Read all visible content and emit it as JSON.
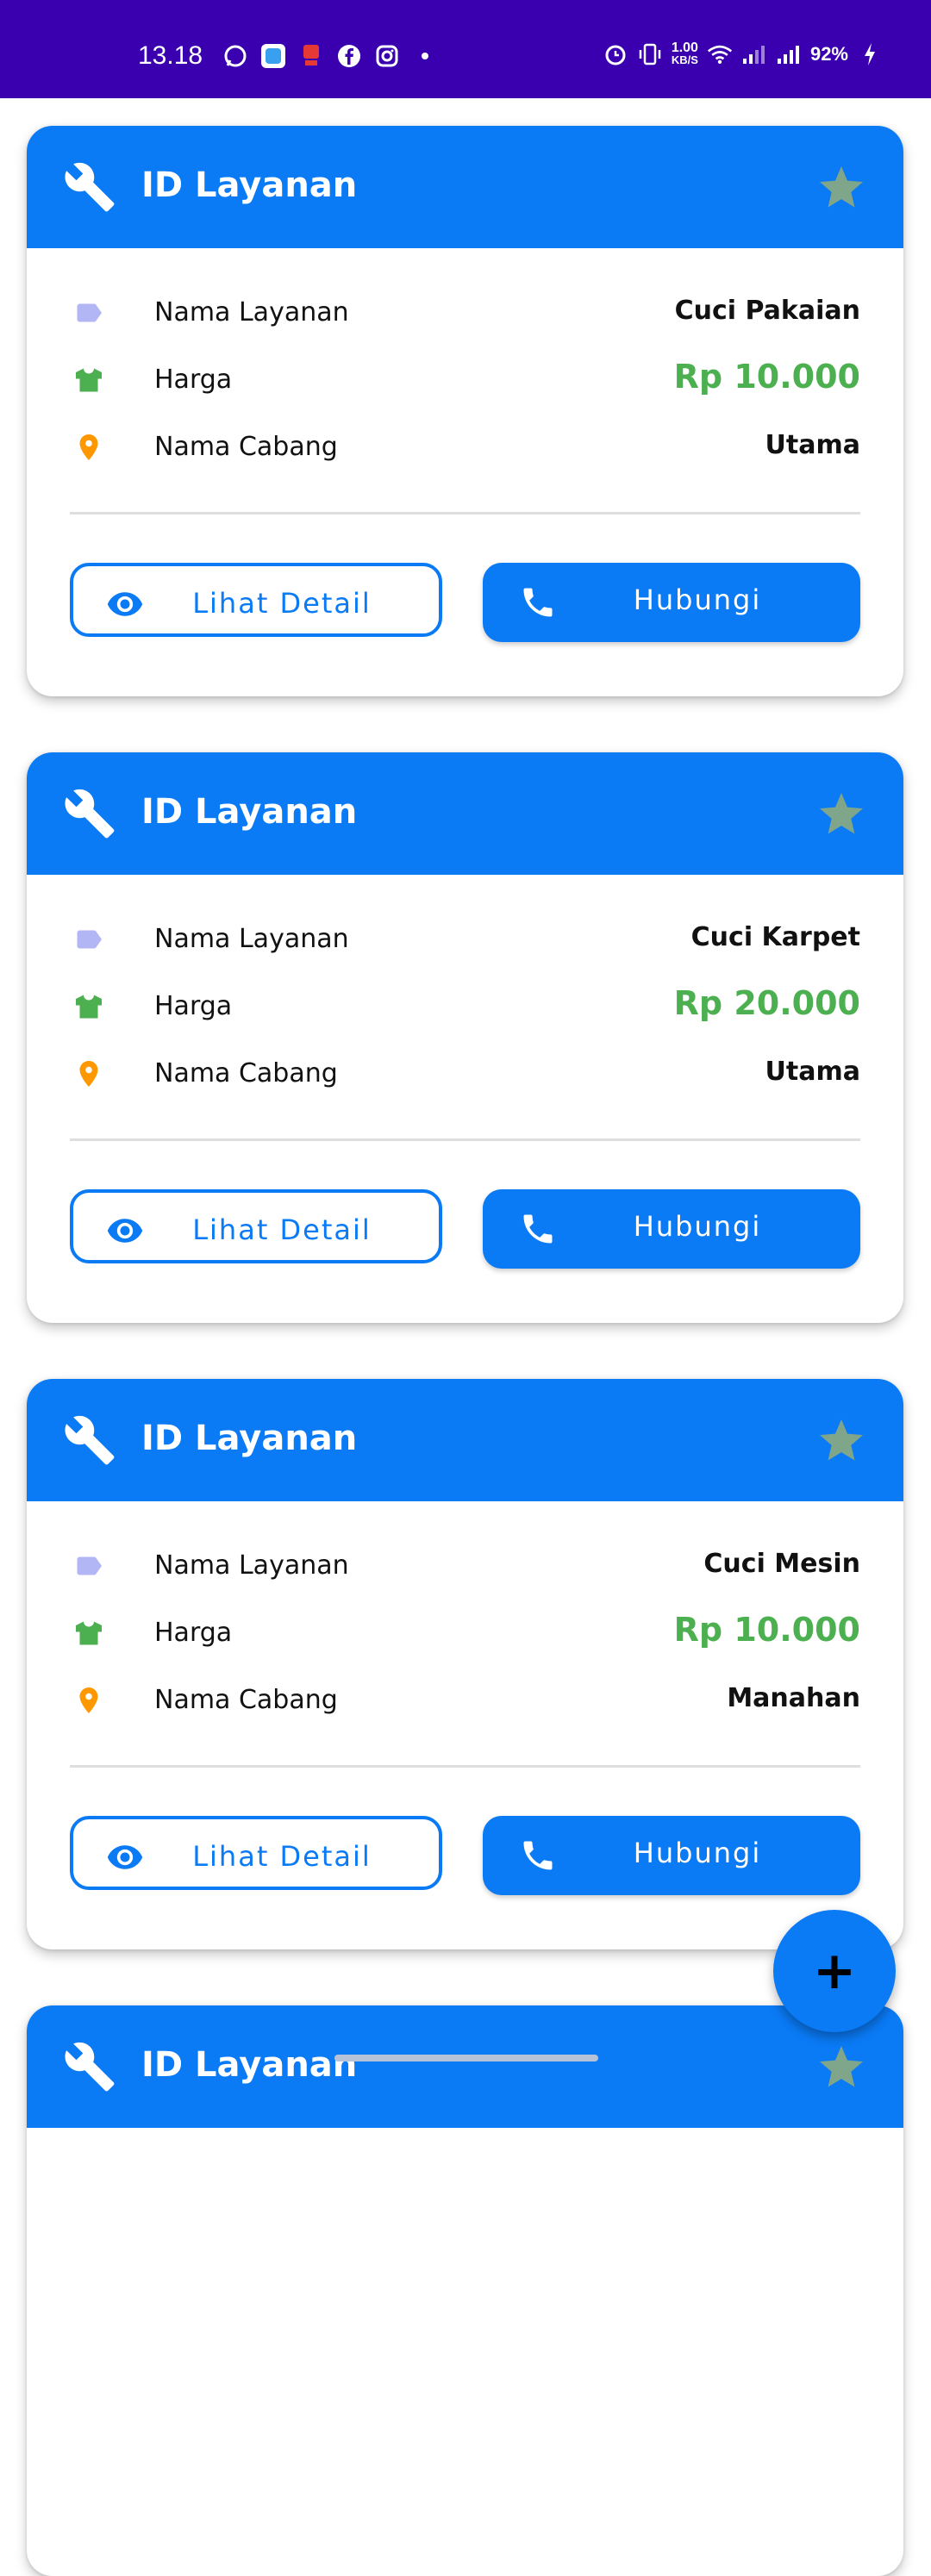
{
  "status_bar": {
    "time": "13.18",
    "speed_value": "1.00",
    "speed_unit": "KB/S",
    "battery": "92%"
  },
  "colors": {
    "header": "#0a7af5",
    "status_bar": "#3a00b0",
    "price": "#4caf50",
    "star": "#7fa58a",
    "tag_icon": "#b3b6f5",
    "shirt_icon": "#4caf50",
    "pin_icon": "#ff9800"
  },
  "cards": [
    {
      "title": "ID Layanan",
      "rows": [
        {
          "icon": "tag-icon",
          "label": "Nama Layanan",
          "value": "Cuci Pakaian"
        },
        {
          "icon": "shirt-icon",
          "label": "Harga",
          "value": "Rp 10.000"
        },
        {
          "icon": "location-pin-icon",
          "label": "Nama Cabang",
          "value": "Utama"
        }
      ],
      "detail_label": "Lihat Detail",
      "call_label": "Hubungi"
    },
    {
      "title": "ID Layanan",
      "rows": [
        {
          "icon": "tag-icon",
          "label": "Nama Layanan",
          "value": "Cuci Karpet"
        },
        {
          "icon": "shirt-icon",
          "label": "Harga",
          "value": "Rp 20.000"
        },
        {
          "icon": "location-pin-icon",
          "label": "Nama Cabang",
          "value": "Utama"
        }
      ],
      "detail_label": "Lihat Detail",
      "call_label": "Hubungi"
    },
    {
      "title": "ID Layanan",
      "rows": [
        {
          "icon": "tag-icon",
          "label": "Nama Layanan",
          "value": "Cuci Mesin"
        },
        {
          "icon": "shirt-icon",
          "label": "Harga",
          "value": "Rp 10.000"
        },
        {
          "icon": "location-pin-icon",
          "label": "Nama Cabang",
          "value": "Manahan"
        }
      ],
      "detail_label": "Lihat Detail",
      "call_label": "Hubungi"
    },
    {
      "title": "ID Layanan"
    }
  ],
  "fab_label": "+"
}
